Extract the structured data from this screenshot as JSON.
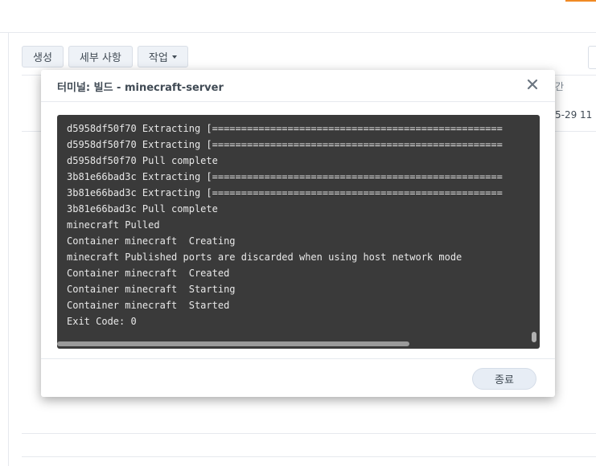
{
  "toolbar": {
    "create_label": "생성",
    "details_label": "세부 사항",
    "action_label": "작업"
  },
  "background": {
    "column_fragment": "간",
    "row_date_fragment": "5-29 11"
  },
  "modal": {
    "title": "터미널: 빌드 - minecraft-server",
    "close_label": "종료",
    "terminal_lines": [
      "d5958df50f70 Extracting [==================================================",
      "d5958df50f70 Extracting [==================================================",
      "d5958df50f70 Pull complete",
      "3b81e66bad3c Extracting [==================================================",
      "3b81e66bad3c Extracting [==================================================",
      "3b81e66bad3c Pull complete",
      "minecraft Pulled",
      "Container minecraft  Creating",
      "minecraft Published ports are discarded when using host network mode",
      "Container minecraft  Created",
      "Container minecraft  Starting",
      "Container minecraft  Started",
      "Exit Code: 0"
    ]
  },
  "colors": {
    "accent": "#f08a24",
    "terminal_bg": "#3a3a3a",
    "terminal_text": "#e8e8e8"
  },
  "icons": {
    "close": "close-icon",
    "dropdown": "chevron-down-icon"
  }
}
